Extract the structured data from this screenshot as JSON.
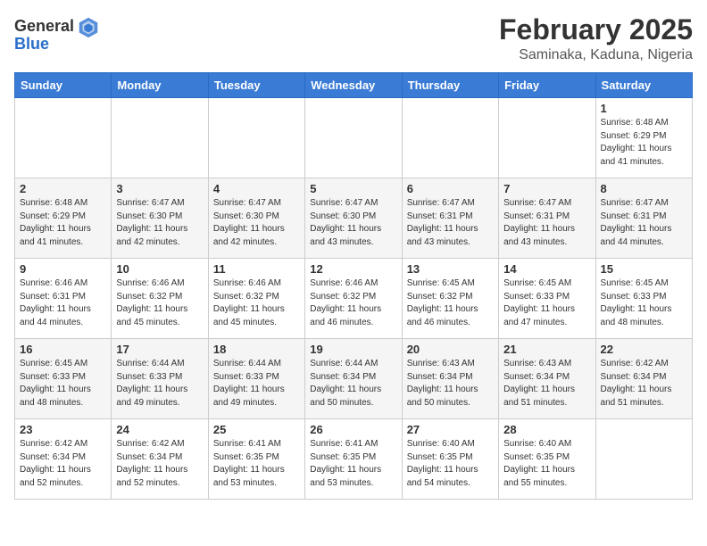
{
  "header": {
    "logo_general": "General",
    "logo_blue": "Blue",
    "month_title": "February 2025",
    "location": "Saminaka, Kaduna, Nigeria"
  },
  "days_of_week": [
    "Sunday",
    "Monday",
    "Tuesday",
    "Wednesday",
    "Thursday",
    "Friday",
    "Saturday"
  ],
  "weeks": [
    [
      {
        "day": "",
        "info": ""
      },
      {
        "day": "",
        "info": ""
      },
      {
        "day": "",
        "info": ""
      },
      {
        "day": "",
        "info": ""
      },
      {
        "day": "",
        "info": ""
      },
      {
        "day": "",
        "info": ""
      },
      {
        "day": "1",
        "info": "Sunrise: 6:48 AM\nSunset: 6:29 PM\nDaylight: 11 hours\nand 41 minutes."
      }
    ],
    [
      {
        "day": "2",
        "info": "Sunrise: 6:48 AM\nSunset: 6:29 PM\nDaylight: 11 hours\nand 41 minutes."
      },
      {
        "day": "3",
        "info": "Sunrise: 6:47 AM\nSunset: 6:30 PM\nDaylight: 11 hours\nand 42 minutes."
      },
      {
        "day": "4",
        "info": "Sunrise: 6:47 AM\nSunset: 6:30 PM\nDaylight: 11 hours\nand 42 minutes."
      },
      {
        "day": "5",
        "info": "Sunrise: 6:47 AM\nSunset: 6:30 PM\nDaylight: 11 hours\nand 43 minutes."
      },
      {
        "day": "6",
        "info": "Sunrise: 6:47 AM\nSunset: 6:31 PM\nDaylight: 11 hours\nand 43 minutes."
      },
      {
        "day": "7",
        "info": "Sunrise: 6:47 AM\nSunset: 6:31 PM\nDaylight: 11 hours\nand 43 minutes."
      },
      {
        "day": "8",
        "info": "Sunrise: 6:47 AM\nSunset: 6:31 PM\nDaylight: 11 hours\nand 44 minutes."
      }
    ],
    [
      {
        "day": "9",
        "info": "Sunrise: 6:46 AM\nSunset: 6:31 PM\nDaylight: 11 hours\nand 44 minutes."
      },
      {
        "day": "10",
        "info": "Sunrise: 6:46 AM\nSunset: 6:32 PM\nDaylight: 11 hours\nand 45 minutes."
      },
      {
        "day": "11",
        "info": "Sunrise: 6:46 AM\nSunset: 6:32 PM\nDaylight: 11 hours\nand 45 minutes."
      },
      {
        "day": "12",
        "info": "Sunrise: 6:46 AM\nSunset: 6:32 PM\nDaylight: 11 hours\nand 46 minutes."
      },
      {
        "day": "13",
        "info": "Sunrise: 6:45 AM\nSunset: 6:32 PM\nDaylight: 11 hours\nand 46 minutes."
      },
      {
        "day": "14",
        "info": "Sunrise: 6:45 AM\nSunset: 6:33 PM\nDaylight: 11 hours\nand 47 minutes."
      },
      {
        "day": "15",
        "info": "Sunrise: 6:45 AM\nSunset: 6:33 PM\nDaylight: 11 hours\nand 48 minutes."
      }
    ],
    [
      {
        "day": "16",
        "info": "Sunrise: 6:45 AM\nSunset: 6:33 PM\nDaylight: 11 hours\nand 48 minutes."
      },
      {
        "day": "17",
        "info": "Sunrise: 6:44 AM\nSunset: 6:33 PM\nDaylight: 11 hours\nand 49 minutes."
      },
      {
        "day": "18",
        "info": "Sunrise: 6:44 AM\nSunset: 6:33 PM\nDaylight: 11 hours\nand 49 minutes."
      },
      {
        "day": "19",
        "info": "Sunrise: 6:44 AM\nSunset: 6:34 PM\nDaylight: 11 hours\nand 50 minutes."
      },
      {
        "day": "20",
        "info": "Sunrise: 6:43 AM\nSunset: 6:34 PM\nDaylight: 11 hours\nand 50 minutes."
      },
      {
        "day": "21",
        "info": "Sunrise: 6:43 AM\nSunset: 6:34 PM\nDaylight: 11 hours\nand 51 minutes."
      },
      {
        "day": "22",
        "info": "Sunrise: 6:42 AM\nSunset: 6:34 PM\nDaylight: 11 hours\nand 51 minutes."
      }
    ],
    [
      {
        "day": "23",
        "info": "Sunrise: 6:42 AM\nSunset: 6:34 PM\nDaylight: 11 hours\nand 52 minutes."
      },
      {
        "day": "24",
        "info": "Sunrise: 6:42 AM\nSunset: 6:34 PM\nDaylight: 11 hours\nand 52 minutes."
      },
      {
        "day": "25",
        "info": "Sunrise: 6:41 AM\nSunset: 6:35 PM\nDaylight: 11 hours\nand 53 minutes."
      },
      {
        "day": "26",
        "info": "Sunrise: 6:41 AM\nSunset: 6:35 PM\nDaylight: 11 hours\nand 53 minutes."
      },
      {
        "day": "27",
        "info": "Sunrise: 6:40 AM\nSunset: 6:35 PM\nDaylight: 11 hours\nand 54 minutes."
      },
      {
        "day": "28",
        "info": "Sunrise: 6:40 AM\nSunset: 6:35 PM\nDaylight: 11 hours\nand 55 minutes."
      },
      {
        "day": "",
        "info": ""
      }
    ]
  ]
}
